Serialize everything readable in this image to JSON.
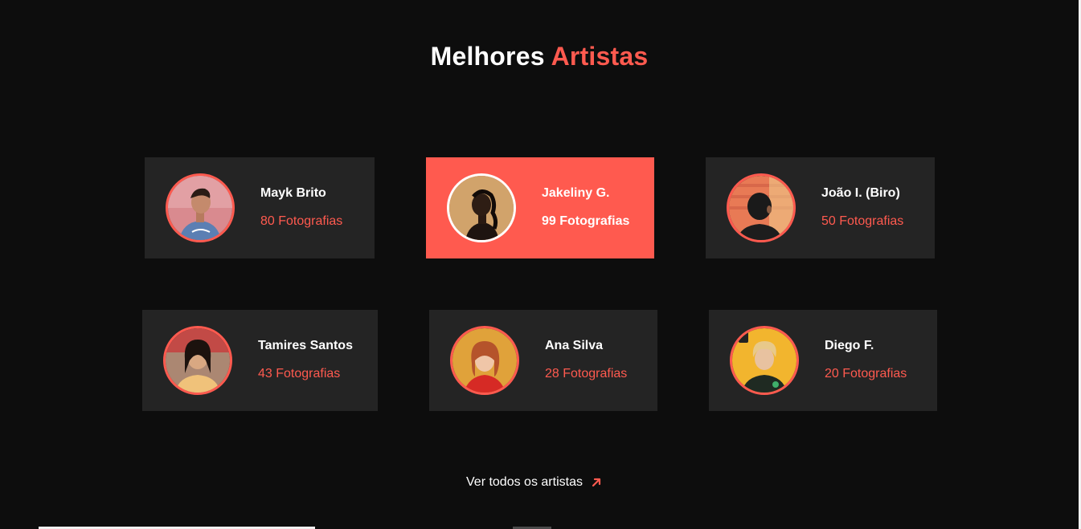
{
  "section": {
    "title_main": "Melhores",
    "title_accent": "Artistas"
  },
  "artists": [
    {
      "name": "Mayk Brito",
      "photos": "80 Fotografias",
      "avatar_icon": "man-profile-avatar"
    },
    {
      "name": "Jakeliny G.",
      "photos": "99 Fotografias",
      "avatar_icon": "woman-profile-avatar",
      "featured": true
    },
    {
      "name": "João I. (Biro)",
      "photos": "50 Fotografias",
      "avatar_icon": "man-back-avatar"
    },
    {
      "name": "Tamires Santos",
      "photos": "43 Fotografias",
      "avatar_icon": "woman-avatar"
    },
    {
      "name": "Ana Silva",
      "photos": "28 Fotografias",
      "avatar_icon": "woman-redhead-avatar"
    },
    {
      "name": "Diego F.",
      "photos": "20 Fotografias",
      "avatar_icon": "man-blond-avatar"
    }
  ],
  "view_all": {
    "label": "Ver todos os artistas",
    "icon": "arrow-up-right-icon"
  },
  "colors": {
    "background": "#0d0d0d",
    "card": "#242424",
    "accent": "#ff5a4f",
    "text": "#ffffff"
  }
}
